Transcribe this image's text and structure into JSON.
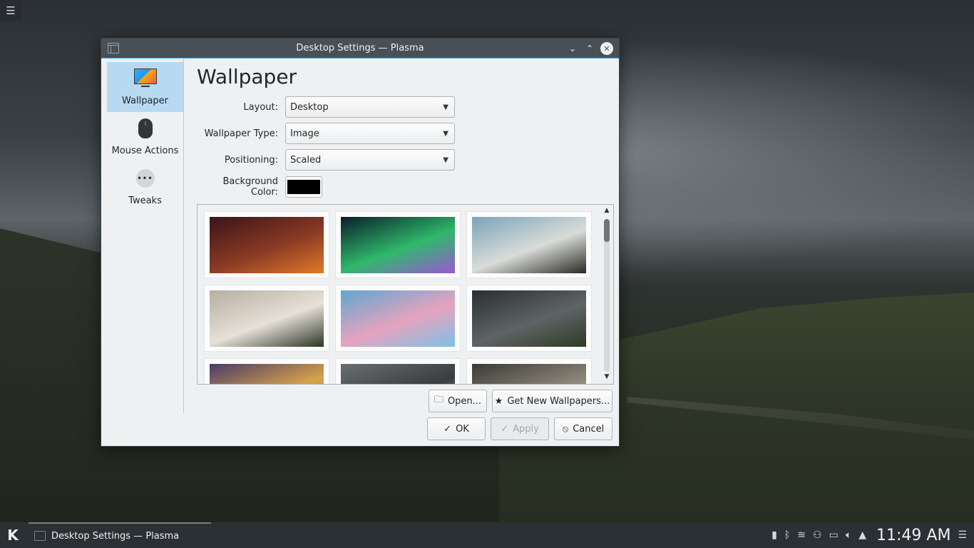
{
  "desktop": {
    "menu_icon": "hamburger-icon"
  },
  "window": {
    "title": "Desktop Settings — Plasma",
    "minimize_glyph": "⌄",
    "maximize_glyph": "⌃",
    "close_glyph": "✕"
  },
  "sidebar": {
    "items": [
      {
        "label": "Wallpaper",
        "icon": "monitor-icon",
        "active": true
      },
      {
        "label": "Mouse Actions",
        "icon": "mouse-icon",
        "active": false
      },
      {
        "label": "Tweaks",
        "icon": "more-icon",
        "active": false
      }
    ]
  },
  "page": {
    "title": "Wallpaper",
    "fields": {
      "layout": {
        "label": "Layout:",
        "value": "Desktop"
      },
      "wallpaper_type": {
        "label": "Wallpaper Type:",
        "value": "Image"
      },
      "positioning": {
        "label": "Positioning:",
        "value": "Scaled"
      },
      "background_color": {
        "label": "Background Color:",
        "value": "#000000"
      }
    },
    "thumbnails": [
      {
        "name": "canyon",
        "colors": [
          "#3a1418",
          "#8a3a24",
          "#e07a2a"
        ]
      },
      {
        "name": "aurora",
        "colors": [
          "#0b1c2a",
          "#2fb86a",
          "#9b58d6"
        ]
      },
      {
        "name": "beach-grass",
        "colors": [
          "#7aa3b8",
          "#d9dcd8",
          "#2a2a26"
        ]
      },
      {
        "name": "winter-tree",
        "colors": [
          "#b8aea2",
          "#e6e0d6",
          "#2c3524"
        ]
      },
      {
        "name": "blossom",
        "colors": [
          "#5fa6cf",
          "#e6a3c0",
          "#7ec1e3"
        ]
      },
      {
        "name": "dark-hills",
        "colors": [
          "#2a2e31",
          "#5e6466",
          "#2e3a24"
        ]
      },
      {
        "name": "bokeh",
        "colors": [
          "#4a3a6a",
          "#d6a24a",
          "#8a8a6a"
        ]
      },
      {
        "name": "stones",
        "colors": [
          "#6a6e70",
          "#3a3e40",
          "#9ea2a4"
        ]
      },
      {
        "name": "rocks",
        "colors": [
          "#3a3a34",
          "#8a8478",
          "#c8c2b6"
        ]
      }
    ],
    "buttons": {
      "open": "Open...",
      "get_new": "Get New Wallpapers..."
    }
  },
  "dialog_buttons": {
    "ok": "OK",
    "apply": "Apply",
    "cancel": "Cancel"
  },
  "taskbar": {
    "launcher_icon": "kde-logo-icon",
    "task_title": "Desktop Settings — Plasma",
    "clock": "11:49 AM",
    "tray_icons": [
      "usb-drive-icon",
      "bluetooth-icon",
      "wifi-icon",
      "user-switch-icon",
      "battery-icon",
      "volume-icon",
      "expand-arrow-icon",
      "panel-menu-icon"
    ]
  }
}
